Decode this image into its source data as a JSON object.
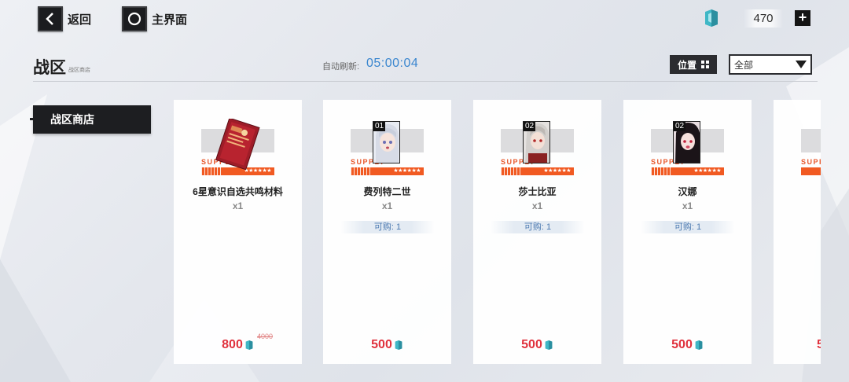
{
  "topbar": {
    "back_label": "返回",
    "home_label": "主界面",
    "currency_value": "470",
    "currency_icon": "crystal-icon",
    "add_currency_symbol": "+"
  },
  "header": {
    "title": "战区",
    "subtitle": "战区商店",
    "refresh_label": "自动刷新:",
    "refresh_time": "05:00:04",
    "position_label": "位置",
    "filter_value": "全部"
  },
  "sidebar": {
    "items": [
      {
        "label": "战区商店"
      }
    ]
  },
  "shop": {
    "supply_text": "SUPPLY",
    "stars": "★★★★★★",
    "items": [
      {
        "name": "6星意识自选共鸣材料",
        "qty": "x1",
        "limit": "",
        "price": "800",
        "old_price": "4000",
        "type": "book",
        "badge": ""
      },
      {
        "name": "费列特二世",
        "qty": "x1",
        "limit": "可购: 1",
        "price": "500",
        "old_price": "",
        "type": "character",
        "badge": "01"
      },
      {
        "name": "莎士比亚",
        "qty": "x1",
        "limit": "可购: 1",
        "price": "500",
        "old_price": "",
        "type": "character",
        "badge": "02"
      },
      {
        "name": "汉娜",
        "qty": "x1",
        "limit": "可购: 1",
        "price": "500",
        "old_price": "",
        "type": "character",
        "badge": "02"
      },
      {
        "name": "",
        "qty": "",
        "limit": "",
        "price": "5",
        "old_price": "",
        "type": "partial",
        "badge": ""
      }
    ]
  },
  "colors": {
    "accent_orange": "#f15a22",
    "price_red": "#e0313d",
    "refresh_blue": "#3a86cf",
    "currency_teal": "#3fb7c6"
  }
}
